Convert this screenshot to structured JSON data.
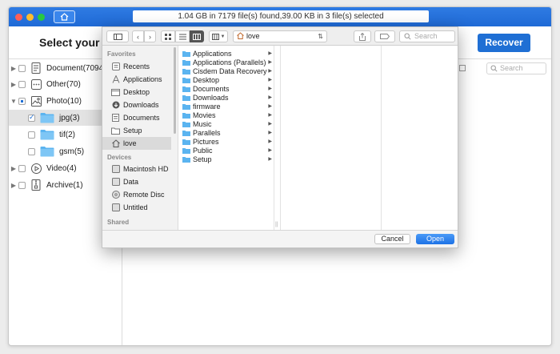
{
  "window": {
    "status_text": "1.04 GB in 7179 file(s) found,39.00 KB in 3 file(s) selected",
    "heading": "Select your lo",
    "recover_label": "Recover",
    "search_placeholder": "Search"
  },
  "tree": [
    {
      "label": "Document(7094)",
      "icon": "document-icon"
    },
    {
      "label": "Other(70)",
      "icon": "other-icon"
    },
    {
      "label": "Photo(10)",
      "icon": "photo-icon"
    },
    {
      "label": "jpg(3)",
      "icon": "folder-icon"
    },
    {
      "label": "tif(2)",
      "icon": "folder-icon"
    },
    {
      "label": "gsm(5)",
      "icon": "folder-icon"
    },
    {
      "label": "Video(4)",
      "icon": "video-icon"
    },
    {
      "label": "Archive(1)",
      "icon": "archive-icon"
    }
  ],
  "dialog": {
    "path_label": "love",
    "search_placeholder": "Search",
    "favorites_header": "Favorites",
    "favorites": [
      "Recents",
      "Applications",
      "Desktop",
      "Downloads",
      "Documents",
      "Setup",
      "love"
    ],
    "devices_header": "Devices",
    "devices": [
      "Macintosh HD",
      "Data",
      "Remote Disc",
      "Untitled"
    ],
    "shared_header": "Shared",
    "files": [
      "Applications",
      "Applications (Parallels)",
      "Cisdem Data Recovery",
      "Desktop",
      "Documents",
      "Downloads",
      "firmware",
      "Movies",
      "Music",
      "Parallels",
      "Pictures",
      "Public",
      "Setup"
    ],
    "cancel_label": "Cancel",
    "open_label": "Open"
  },
  "colors": {
    "titlebar": "#1f6ad6",
    "accent": "#1f6fd4",
    "folder": "#5bb4f0"
  }
}
